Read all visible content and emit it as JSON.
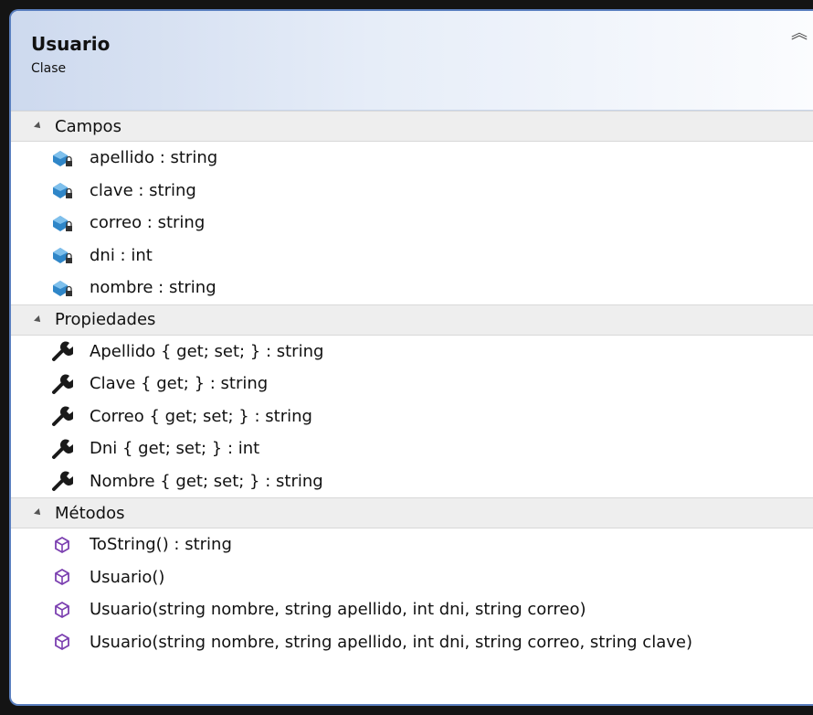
{
  "header": {
    "title": "Usuario",
    "subtitle": "Clase",
    "collapse_icon": "double-chevron-up-icon"
  },
  "sections": {
    "fields": {
      "label": "Campos",
      "icon": "private-field-icon",
      "items": [
        "apellido : string",
        "clave : string",
        "correo : string",
        "dni : int",
        "nombre : string"
      ]
    },
    "properties": {
      "label": "Propiedades",
      "icon": "wrench-icon",
      "items": [
        "Apellido { get; set; } : string",
        "Clave { get; } : string",
        "Correo { get; set; } : string",
        "Dni { get; set; } : int",
        "Nombre { get; set; } : string"
      ]
    },
    "methods": {
      "label": "Métodos",
      "icon": "method-cube-icon",
      "items": [
        "ToString() : string",
        "Usuario()",
        "Usuario(string nombre, string apellido, int dni, string correo)",
        "Usuario(string nombre, string apellido, int dni, string correo, string clave)"
      ]
    }
  },
  "colors": {
    "border": "#5a7fbf",
    "field_icon": "#2f86c8",
    "method_icon": "#7b3fb0"
  }
}
